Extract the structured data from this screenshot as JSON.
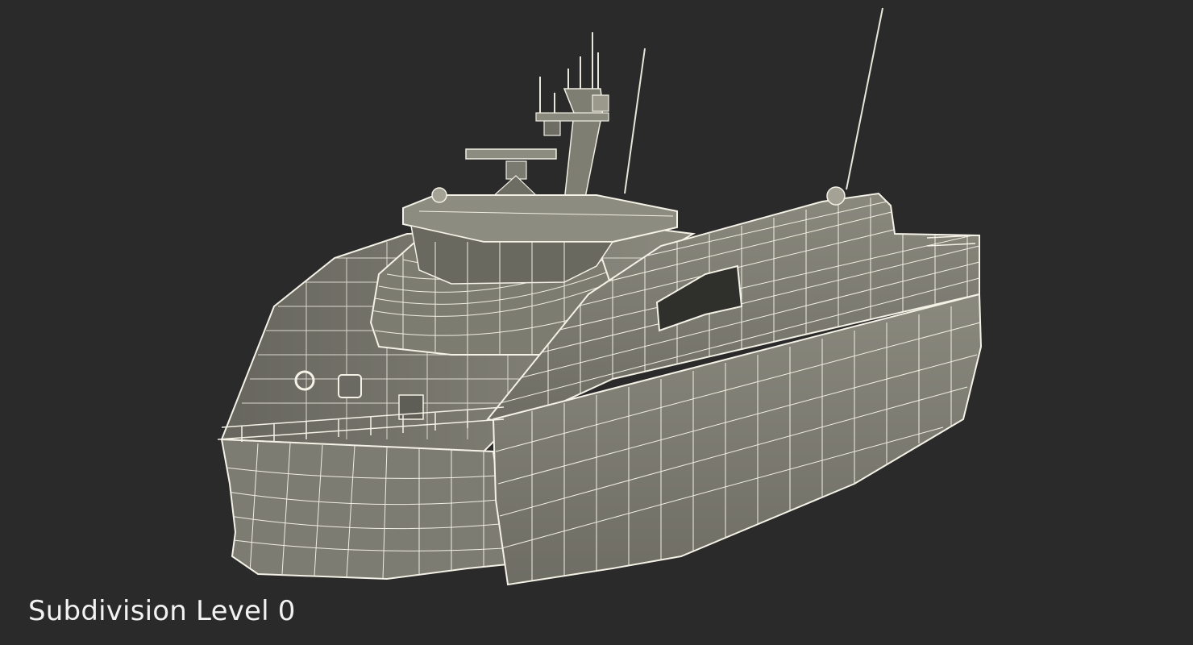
{
  "viewport": {
    "background": "#2a2a2a",
    "caption": "Subdivision Level 0"
  },
  "model": {
    "subject": "catamaran-patrol-vessel",
    "shading": "wireframe-on-clay",
    "colors": {
      "surface": "#7b7a70",
      "surface_light": "#8d8c81",
      "surface_dark": "#55544c",
      "wire": "#f4f2e6",
      "shadow": "#3b3b36"
    }
  }
}
